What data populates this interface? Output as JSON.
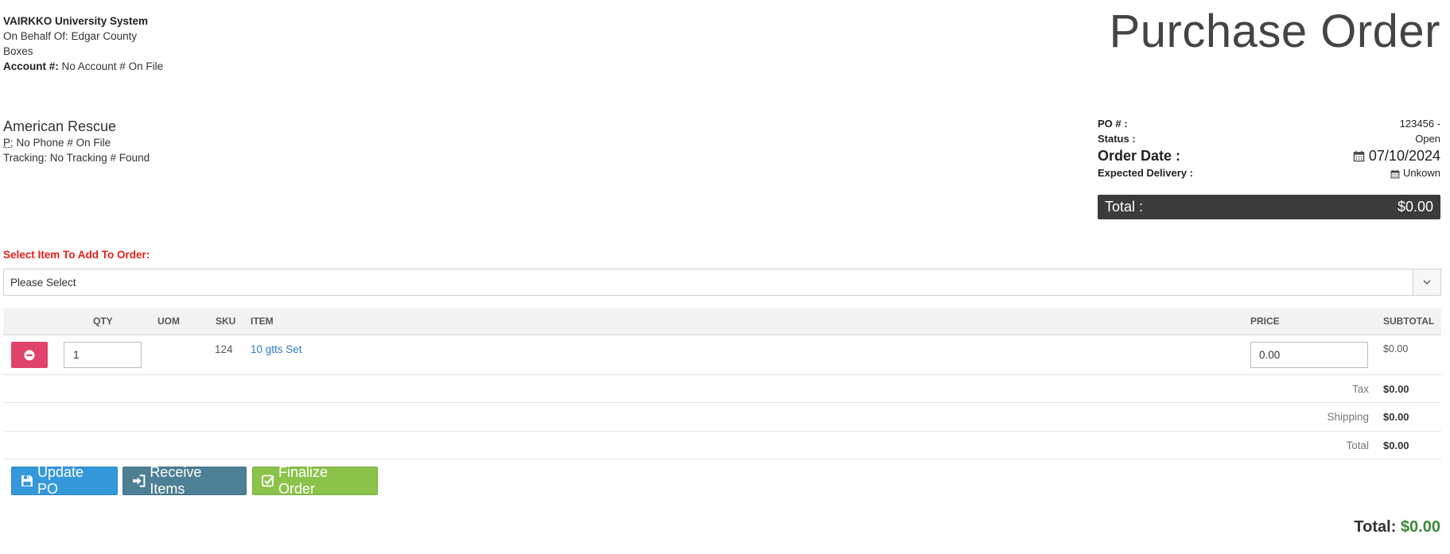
{
  "org": {
    "name": "VAIRKKO University System",
    "on_behalf": "On Behalf Of: Edgar County",
    "dept": "Boxes",
    "account_label": "Account #:",
    "account_value": " No Account # On File"
  },
  "title": "Purchase Order",
  "vendor": {
    "name": "American Rescue",
    "phone_label": "P:",
    "phone_value": " No Phone # On File",
    "tracking": "Tracking: No Tracking # Found"
  },
  "po": {
    "po_label": "PO # :",
    "po_value": "123456 -",
    "status_label": "Status :",
    "status_value": "Open",
    "order_date_label": "Order Date :",
    "order_date_value": "07/10/2024",
    "delivery_label": "Expected Delivery :",
    "delivery_value": "Unkown",
    "total_label": "Total :",
    "total_value": "$0.00"
  },
  "select": {
    "label": "Select Item To Add To Order:",
    "value": "Please Select"
  },
  "table": {
    "headers": {
      "qty": "QTY",
      "uom": "UOM",
      "sku": "SKU",
      "item": "ITEM",
      "price": "PRICE",
      "subtotal": "SUBTOTAL"
    },
    "rows": [
      {
        "qty": "1",
        "uom": "",
        "sku": "124",
        "item": "10 gtts Set",
        "price": "0.00",
        "subtotal": "$0.00"
      }
    ]
  },
  "summary": {
    "tax_label": "Tax",
    "tax_value": "$0.00",
    "shipping_label": "Shipping",
    "shipping_value": "$0.00",
    "total_label": "Total",
    "total_value": "$0.00"
  },
  "buttons": {
    "update": "Update PO",
    "receive": "Receive Items",
    "finalize": "Finalize Order"
  },
  "grand_total": {
    "label": "Total: ",
    "value": "$0.00"
  },
  "colors": {
    "danger": "#e0446a",
    "primary": "#3498db",
    "info": "#4d7f95",
    "success": "#8bc34a",
    "select_label": "#e8201b",
    "link": "#2f79c2",
    "grand_total": "#3a8a3a",
    "total_bar": "#3b3b3b"
  },
  "icons": {
    "remove": "minus-circle-icon",
    "update": "save-icon",
    "receive": "sign-in-icon",
    "finalize": "check-square-icon",
    "calendar": "calendar-icon",
    "dropdown": "chevron-down-icon"
  }
}
